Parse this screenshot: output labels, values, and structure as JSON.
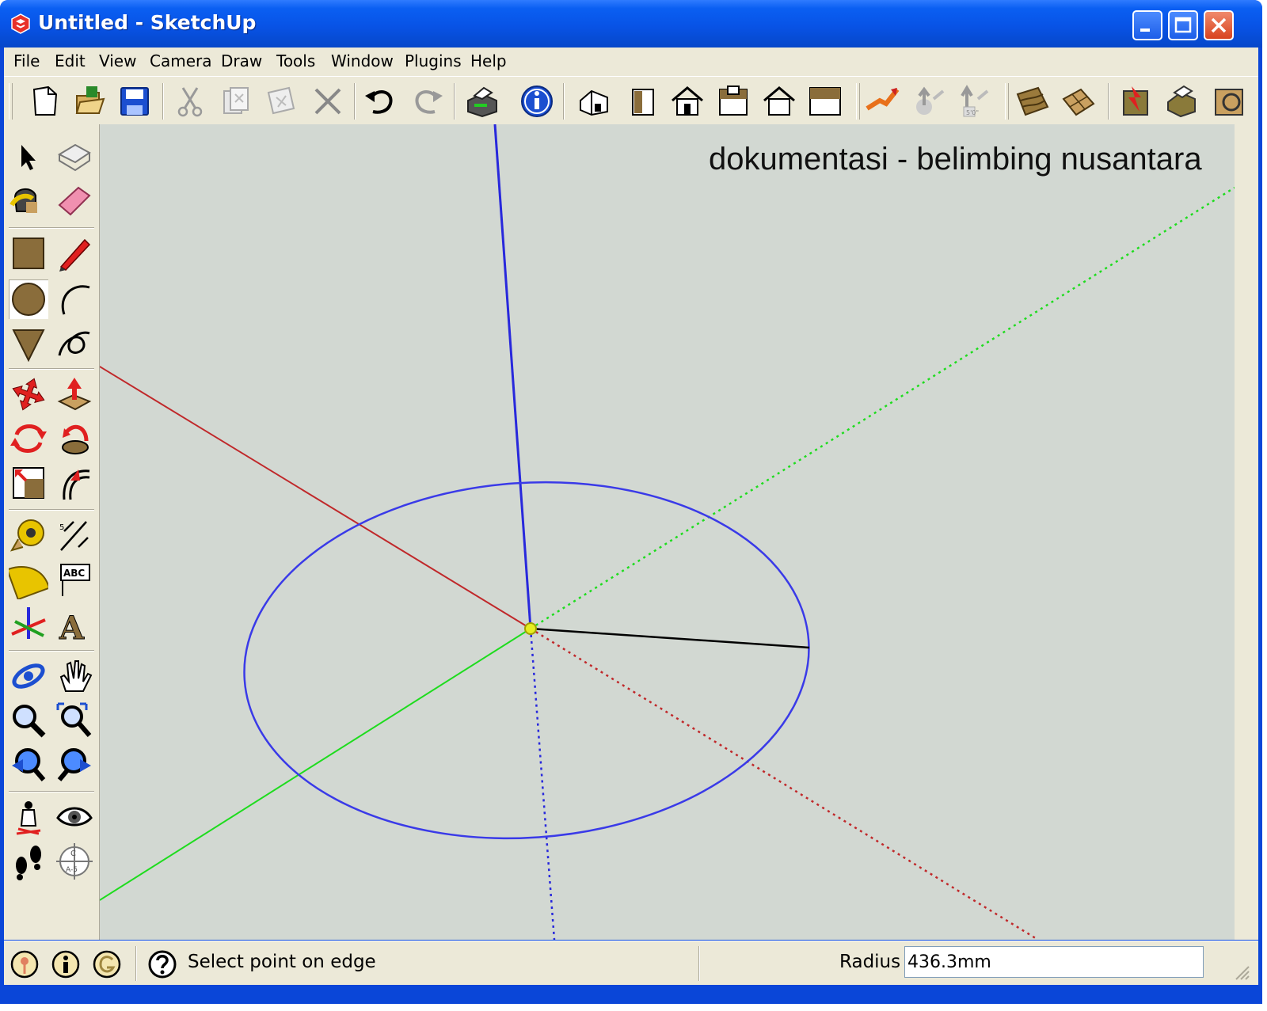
{
  "window": {
    "title": "Untitled - SketchUp"
  },
  "window_controls": [
    "minimize-icon",
    "maximize-icon",
    "close-icon"
  ],
  "menu": [
    "File",
    "Edit",
    "View",
    "Camera",
    "Draw",
    "Tools",
    "Window",
    "Plugins",
    "Help"
  ],
  "toolbar_icons": [
    "new-file-icon",
    "open-folder-icon",
    "save-icon",
    "cut-icon",
    "copy-icon",
    "paste-icon",
    "erase-icon",
    "undo-icon",
    "redo-icon",
    "print-icon",
    "model-info-icon",
    "iso-view-icon",
    "top-view-icon",
    "front-view-icon",
    "right-view-icon",
    "back-view-icon",
    "left-view-icon",
    "sandbox-from-contours-icon",
    "sandbox-smoove-icon",
    "sandbox-stamp-icon",
    "sandbox-drape-icon",
    "sandbox-add-detail-icon",
    "google-earth-icon",
    "3d-warehouse-icon"
  ],
  "tools_palette": [
    "select-icon",
    "make-component-icon",
    "paint-bucket-icon",
    "eraser-icon",
    "rectangle-icon",
    "pencil-line-icon",
    "circle-icon",
    "arc-icon",
    "polygon-icon",
    "freehand-icon",
    "move-icon",
    "push-pull-icon",
    "rotate-icon",
    "follow-me-icon",
    "scale-icon",
    "offset-icon",
    "tape-measure-icon",
    "dimension-icon",
    "protractor-icon",
    "text-label-icon",
    "axes-icon",
    "3d-text-icon",
    "orbit-icon",
    "pan-icon",
    "zoom-icon",
    "zoom-window-icon",
    "previous-view-icon",
    "zoom-extents-icon",
    "position-camera-icon",
    "look-around-icon",
    "walk-icon",
    "section-plane-icon"
  ],
  "viewport": {
    "watermark": "dokumentasi - belimbing nusantara",
    "background": "#d2d8d2",
    "colors": {
      "red_axis": "#c0282a",
      "green_axis": "#1edc1e",
      "blue_axis": "#2828dc",
      "circle": "#3a3ae8"
    }
  },
  "status": {
    "icons": [
      "geo-location-icon",
      "credits-icon",
      "google-signin-icon",
      "help-icon"
    ],
    "message": "Select point on edge",
    "vcb_label": "Radius",
    "vcb_value": "436.3mm"
  }
}
